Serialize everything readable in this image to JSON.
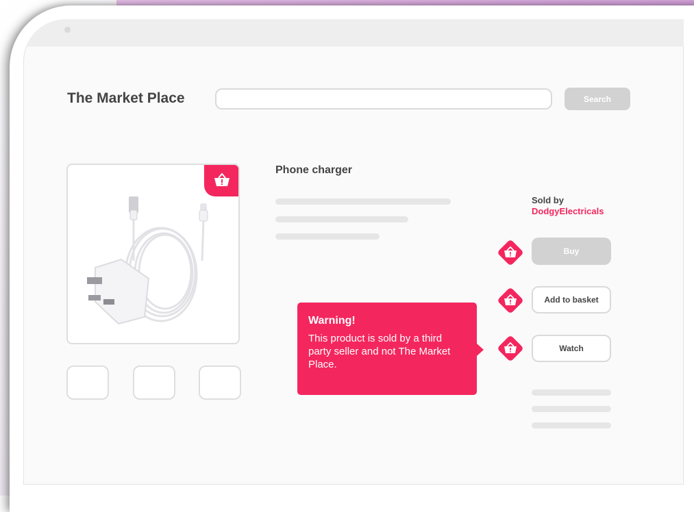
{
  "header": {
    "brand": "The Market Place",
    "search": {
      "placeholder": "",
      "button_label": "Search"
    }
  },
  "product": {
    "title": "Phone charger",
    "image_icon": "basket-alert-icon",
    "thumbnails": 3
  },
  "seller": {
    "label": "Sold by",
    "name": "DodgyElectricals"
  },
  "actions": {
    "buy": "Buy",
    "add_to_basket": "Add to basket",
    "watch": "Watch"
  },
  "warning": {
    "title": "Warning!",
    "body": "This product is sold by a third party seller and not The Market Place."
  },
  "colors": {
    "accent": "#f4265e",
    "disabled": "#d2d2d2",
    "text": "#444444"
  }
}
